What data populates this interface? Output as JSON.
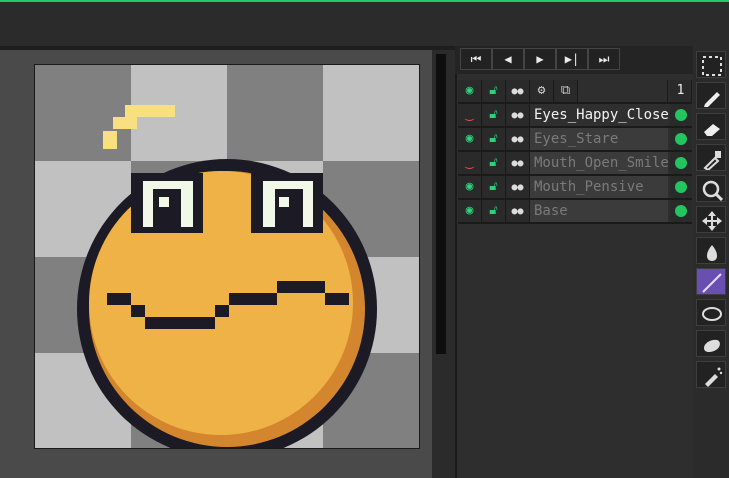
{
  "timeline": {
    "buttons": [
      {
        "icon": "first-frame-icon",
        "glyph": "⏮"
      },
      {
        "icon": "prev-frame-icon",
        "glyph": "◀"
      },
      {
        "icon": "play-icon",
        "glyph": "▶"
      },
      {
        "icon": "next-frame-icon",
        "glyph": "▶|"
      },
      {
        "icon": "last-frame-icon",
        "glyph": "⏭"
      }
    ]
  },
  "layers": {
    "header_frame_number": "1",
    "rows": [
      {
        "name": "Eyes_Happy_Closed",
        "visible": false,
        "active": true
      },
      {
        "name": "Eyes_Stare",
        "visible": true,
        "active": false
      },
      {
        "name": "Mouth_Open_Smile",
        "visible": false,
        "active": false
      },
      {
        "name": "Mouth_Pensive",
        "visible": true,
        "active": false
      },
      {
        "name": "Base",
        "visible": true,
        "active": false
      }
    ]
  },
  "tools": [
    "marquee-icon",
    "pencil-icon",
    "eraser-icon",
    "eyedropper-icon",
    "zoom-icon",
    "move-icon",
    "fill-icon",
    "line-icon",
    "ellipse-icon",
    "blur-icon",
    "spray-icon"
  ],
  "colors": {
    "face": "#efb246",
    "outline": "#1c1a24",
    "shade": "#d4862e",
    "highlight": "#f8e080",
    "eye_white": "#f1f8e8",
    "accent": "#28c76b",
    "active_tool": "#6a4fb3"
  }
}
